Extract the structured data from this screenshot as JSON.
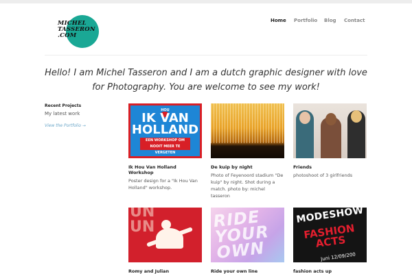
{
  "brand": {
    "logo_lines": [
      "MICHEL",
      "TASSERON",
      ".COM"
    ],
    "accent": "#1aa895"
  },
  "nav": [
    {
      "label": "Home",
      "active": true
    },
    {
      "label": "Portfolio",
      "active": false
    },
    {
      "label": "Blog",
      "active": false
    },
    {
      "label": "Contact",
      "active": false
    }
  ],
  "tagline": "Hello! I am Michel Tasseron and I am a dutch graphic designer with love for Photography. You are welcome to see my work!",
  "sidebar": {
    "title": "Recent Projects",
    "subtitle": "My latest work",
    "link": "View the Portfolio →"
  },
  "projects": [
    {
      "title": "Ik Hou Van Holland Workshop",
      "description": "Poster design for a \"Ik Hou Van Holland\" workshop.",
      "thumb_text": {
        "heart": "HOU",
        "line1": "IK",
        "line2": "VAN",
        "line3": "HOLLAND",
        "band1": "EEN WORKSHOP OM",
        "band2": "NOOIT MEER TE VERGETEN"
      }
    },
    {
      "title": "De kuip by night",
      "description": "Photo of Feyenoord stadium \"De kuip\" by night. Shot during a match. photo by: michel tasseron"
    },
    {
      "title": "Friends",
      "description": "photoshoot of 3 girlfriends"
    },
    {
      "title": "Romy and Julian",
      "description": "",
      "thumb_text": {
        "letters": "UN\nUN"
      }
    },
    {
      "title": "Ride your own line",
      "description": "",
      "thumb_text": {
        "words": "RIDE\nYOUR\nOWN"
      }
    },
    {
      "title": "fashion acts up",
      "description": "",
      "thumb_text": {
        "a": "MODESHOW",
        "b": "FASHION\nACTS",
        "c": "Juni 12/09/200"
      }
    }
  ]
}
